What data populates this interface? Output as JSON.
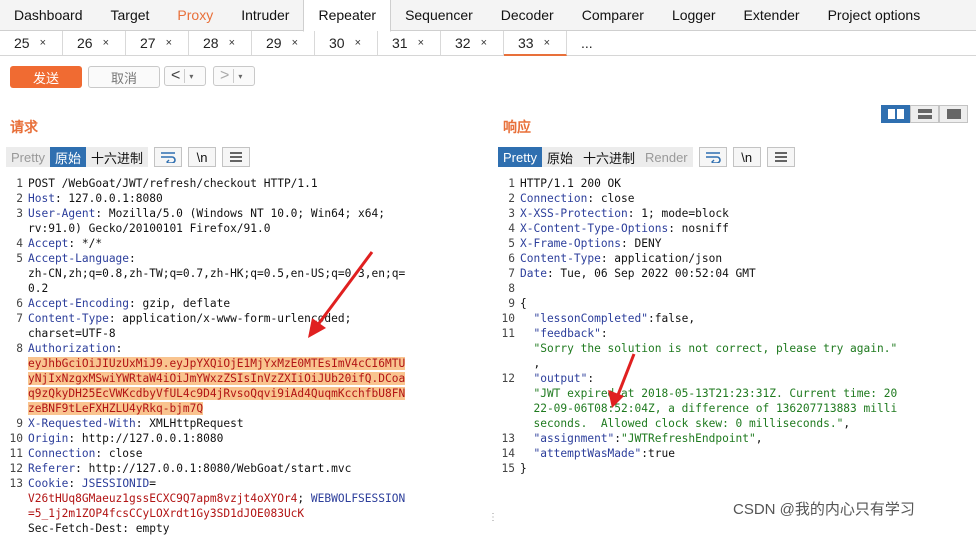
{
  "top_tabs": [
    {
      "label": "Dashboard"
    },
    {
      "label": "Target"
    },
    {
      "label": "Proxy"
    },
    {
      "label": "Intruder"
    },
    {
      "label": "Repeater"
    },
    {
      "label": "Sequencer"
    },
    {
      "label": "Decoder"
    },
    {
      "label": "Comparer"
    },
    {
      "label": "Logger"
    },
    {
      "label": "Extender"
    },
    {
      "label": "Project options"
    }
  ],
  "sub_tabs": [
    {
      "label": "25",
      "close": "×"
    },
    {
      "label": "26",
      "close": "×"
    },
    {
      "label": "27",
      "close": "×"
    },
    {
      "label": "28",
      "close": "×"
    },
    {
      "label": "29",
      "close": "×"
    },
    {
      "label": "30",
      "close": "×"
    },
    {
      "label": "31",
      "close": "×"
    },
    {
      "label": "32",
      "close": "×"
    },
    {
      "label": "33",
      "close": "×"
    },
    {
      "label": "...",
      "close": ""
    }
  ],
  "toolbar": {
    "send": "发送",
    "cancel": "取消",
    "back": "<",
    "forward": ">",
    "dropdown": "▾"
  },
  "request": {
    "title": "请求",
    "tools": [
      "Pretty",
      "原始",
      "十六进制"
    ],
    "icon_newline": "\\n",
    "lines": [
      {
        "n": "1",
        "parts": [
          {
            "t": "POST /WebGoat/JWT/refresh/checkout HTTP/1.1",
            "c": ""
          }
        ]
      },
      {
        "n": "2",
        "parts": [
          {
            "t": "Host",
            "c": "k"
          },
          {
            "t": ": 127.0.0.1:8080",
            "c": ""
          }
        ]
      },
      {
        "n": "3",
        "parts": [
          {
            "t": "User-Agent",
            "c": "k"
          },
          {
            "t": ": Mozilla/5.0 (Windows NT 10.0; Win64; x64;",
            "c": ""
          }
        ]
      },
      {
        "n": "",
        "parts": [
          {
            "t": "rv:91.0) Gecko/20100101 Firefox/91.0",
            "c": ""
          }
        ]
      },
      {
        "n": "4",
        "parts": [
          {
            "t": "Accept",
            "c": "k"
          },
          {
            "t": ": */*",
            "c": ""
          }
        ]
      },
      {
        "n": "5",
        "parts": [
          {
            "t": "Accept-Language",
            "c": "k"
          },
          {
            "t": ":",
            "c": ""
          }
        ]
      },
      {
        "n": "",
        "parts": [
          {
            "t": "zh-CN,zh;q=0.8,zh-TW;q=0.7,zh-HK;q=0.5,en-US;q=0.3,en;q=",
            "c": ""
          }
        ]
      },
      {
        "n": "",
        "parts": [
          {
            "t": "0.2",
            "c": ""
          }
        ]
      },
      {
        "n": "6",
        "parts": [
          {
            "t": "Accept-Encoding",
            "c": "k"
          },
          {
            "t": ": gzip, deflate",
            "c": ""
          }
        ]
      },
      {
        "n": "7",
        "parts": [
          {
            "t": "Content-Type",
            "c": "k"
          },
          {
            "t": ": application/x-www-form-urlencoded;",
            "c": ""
          }
        ]
      },
      {
        "n": "",
        "parts": [
          {
            "t": "charset=UTF-8",
            "c": ""
          }
        ]
      },
      {
        "n": "8",
        "parts": [
          {
            "t": "Authorization",
            "c": "k"
          },
          {
            "t": ":",
            "c": ""
          }
        ]
      },
      {
        "n": "",
        "parts": [
          {
            "t": "eyJhbGciOiJIUzUxMiJ9.eyJpYXQiOjE1MjYxMzE0MTEsImV4cCI6MTU",
            "c": "hl"
          }
        ]
      },
      {
        "n": "",
        "parts": [
          {
            "t": "yNjIxNzgxMSwiYWRtaW4iOiJmYWxzZSIsInVzZXIiOiJUb20ifQ.DCoa",
            "c": "hl"
          }
        ]
      },
      {
        "n": "",
        "parts": [
          {
            "t": "q9zQkyDH25EcVWKcdbyVfUL4c9D4jRvsoQqvi9iAd4QuqmKcchfbU8FN",
            "c": "hl"
          }
        ]
      },
      {
        "n": "",
        "parts": [
          {
            "t": "zeBNF9tLeFXHZLU4yRkq-bjm7Q",
            "c": "hl"
          }
        ]
      },
      {
        "n": "9",
        "parts": [
          {
            "t": "X-Requested-With",
            "c": "k"
          },
          {
            "t": ": XMLHttpRequest",
            "c": ""
          }
        ]
      },
      {
        "n": "10",
        "parts": [
          {
            "t": "Origin",
            "c": "k"
          },
          {
            "t": ": http://127.0.0.1:8080",
            "c": ""
          }
        ]
      },
      {
        "n": "11",
        "parts": [
          {
            "t": "Connection",
            "c": "k"
          },
          {
            "t": ": close",
            "c": ""
          }
        ]
      },
      {
        "n": "12",
        "parts": [
          {
            "t": "Referer",
            "c": "k"
          },
          {
            "t": ": http://127.0.0.1:8080/WebGoat/start.mvc",
            "c": ""
          }
        ]
      },
      {
        "n": "13",
        "parts": [
          {
            "t": "Cookie",
            "c": "k"
          },
          {
            "t": ": ",
            "c": ""
          },
          {
            "t": "JSESSIONID",
            "c": "k"
          },
          {
            "t": "=",
            "c": ""
          }
        ]
      },
      {
        "n": "",
        "parts": [
          {
            "t": "V26tHUq8GMaeuz1gssECXC9Q7apm8vzjt4oXYOr4",
            "c": "sv"
          },
          {
            "t": "; ",
            "c": ""
          },
          {
            "t": "WEBWOLFSESSION",
            "c": "k"
          }
        ]
      },
      {
        "n": "",
        "parts": [
          {
            "t": "=5_1j2m1ZOP4fcsCCyLOXrdt1Gy3SD1dJOE083UcK",
            "c": "sv"
          }
        ]
      },
      {
        "n": "",
        "parts": [
          {
            "t": "Sec-Fetch-Dest: empty",
            "c": ""
          }
        ]
      }
    ]
  },
  "response": {
    "title": "响应",
    "tools": [
      "Pretty",
      "原始",
      "十六进制",
      "Render"
    ],
    "icon_newline": "\\n",
    "lines": [
      {
        "n": "1",
        "parts": [
          {
            "t": "HTTP/1.1 200 OK",
            "c": ""
          }
        ]
      },
      {
        "n": "2",
        "parts": [
          {
            "t": "Connection",
            "c": "k"
          },
          {
            "t": ": close",
            "c": ""
          }
        ]
      },
      {
        "n": "3",
        "parts": [
          {
            "t": "X-XSS-Protection",
            "c": "k"
          },
          {
            "t": ": 1; mode=block",
            "c": ""
          }
        ]
      },
      {
        "n": "4",
        "parts": [
          {
            "t": "X-Content-Type-Options",
            "c": "k"
          },
          {
            "t": ": nosniff",
            "c": ""
          }
        ]
      },
      {
        "n": "5",
        "parts": [
          {
            "t": "X-Frame-Options",
            "c": "k"
          },
          {
            "t": ": DENY",
            "c": ""
          }
        ]
      },
      {
        "n": "6",
        "parts": [
          {
            "t": "Content-Type",
            "c": "k"
          },
          {
            "t": ": application/json",
            "c": ""
          }
        ]
      },
      {
        "n": "7",
        "parts": [
          {
            "t": "Date",
            "c": "k"
          },
          {
            "t": ": Tue, 06 Sep 2022 00:52:04 GMT",
            "c": ""
          }
        ]
      },
      {
        "n": "8",
        "parts": [
          {
            "t": "",
            "c": ""
          }
        ]
      },
      {
        "n": "9",
        "parts": [
          {
            "t": "{",
            "c": ""
          }
        ]
      },
      {
        "n": "10",
        "parts": [
          {
            "t": "  \"lessonCompleted\"",
            "c": "k"
          },
          {
            "t": ":false,",
            "c": ""
          }
        ]
      },
      {
        "n": "11",
        "parts": [
          {
            "t": "  \"feedback\"",
            "c": "k"
          },
          {
            "t": ":",
            "c": ""
          }
        ]
      },
      {
        "n": "",
        "parts": [
          {
            "t": "  \"Sorry the solution is not correct, please try again.\"",
            "c": "str"
          }
        ]
      },
      {
        "n": "",
        "parts": [
          {
            "t": "  ,",
            "c": ""
          }
        ]
      },
      {
        "n": "12",
        "parts": [
          {
            "t": "  \"output\"",
            "c": "k"
          },
          {
            "t": ":",
            "c": ""
          }
        ]
      },
      {
        "n": "",
        "parts": [
          {
            "t": "  \"JWT expired at 2018-05-13T21:23:31Z. Current time: 20",
            "c": "str"
          }
        ]
      },
      {
        "n": "",
        "parts": [
          {
            "t": "  22-09-06T08:52:04Z, a difference of 136207713883 milli",
            "c": "str"
          }
        ]
      },
      {
        "n": "",
        "parts": [
          {
            "t": "  seconds.  Allowed clock skew: 0 milliseconds.\"",
            "c": "str"
          },
          {
            "t": ",",
            "c": ""
          }
        ]
      },
      {
        "n": "13",
        "parts": [
          {
            "t": "  \"assignment\"",
            "c": "k"
          },
          {
            "t": ":",
            "c": ""
          },
          {
            "t": "\"JWTRefreshEndpoint\"",
            "c": "str"
          },
          {
            "t": ",",
            "c": ""
          }
        ]
      },
      {
        "n": "14",
        "parts": [
          {
            "t": "  \"attemptWasMade\"",
            "c": "k"
          },
          {
            "t": ":true",
            "c": ""
          }
        ]
      },
      {
        "n": "15",
        "parts": [
          {
            "t": "}",
            "c": ""
          }
        ]
      }
    ]
  },
  "watermark": "CSDN @我的内心只有学习",
  "colors": {
    "accent": "#e8703a",
    "selected": "#2f6fb0",
    "header_key": "#2c3e9b",
    "value_red": "#b21414",
    "string_green": "#1f7a1f",
    "arrow": "#e02020"
  }
}
